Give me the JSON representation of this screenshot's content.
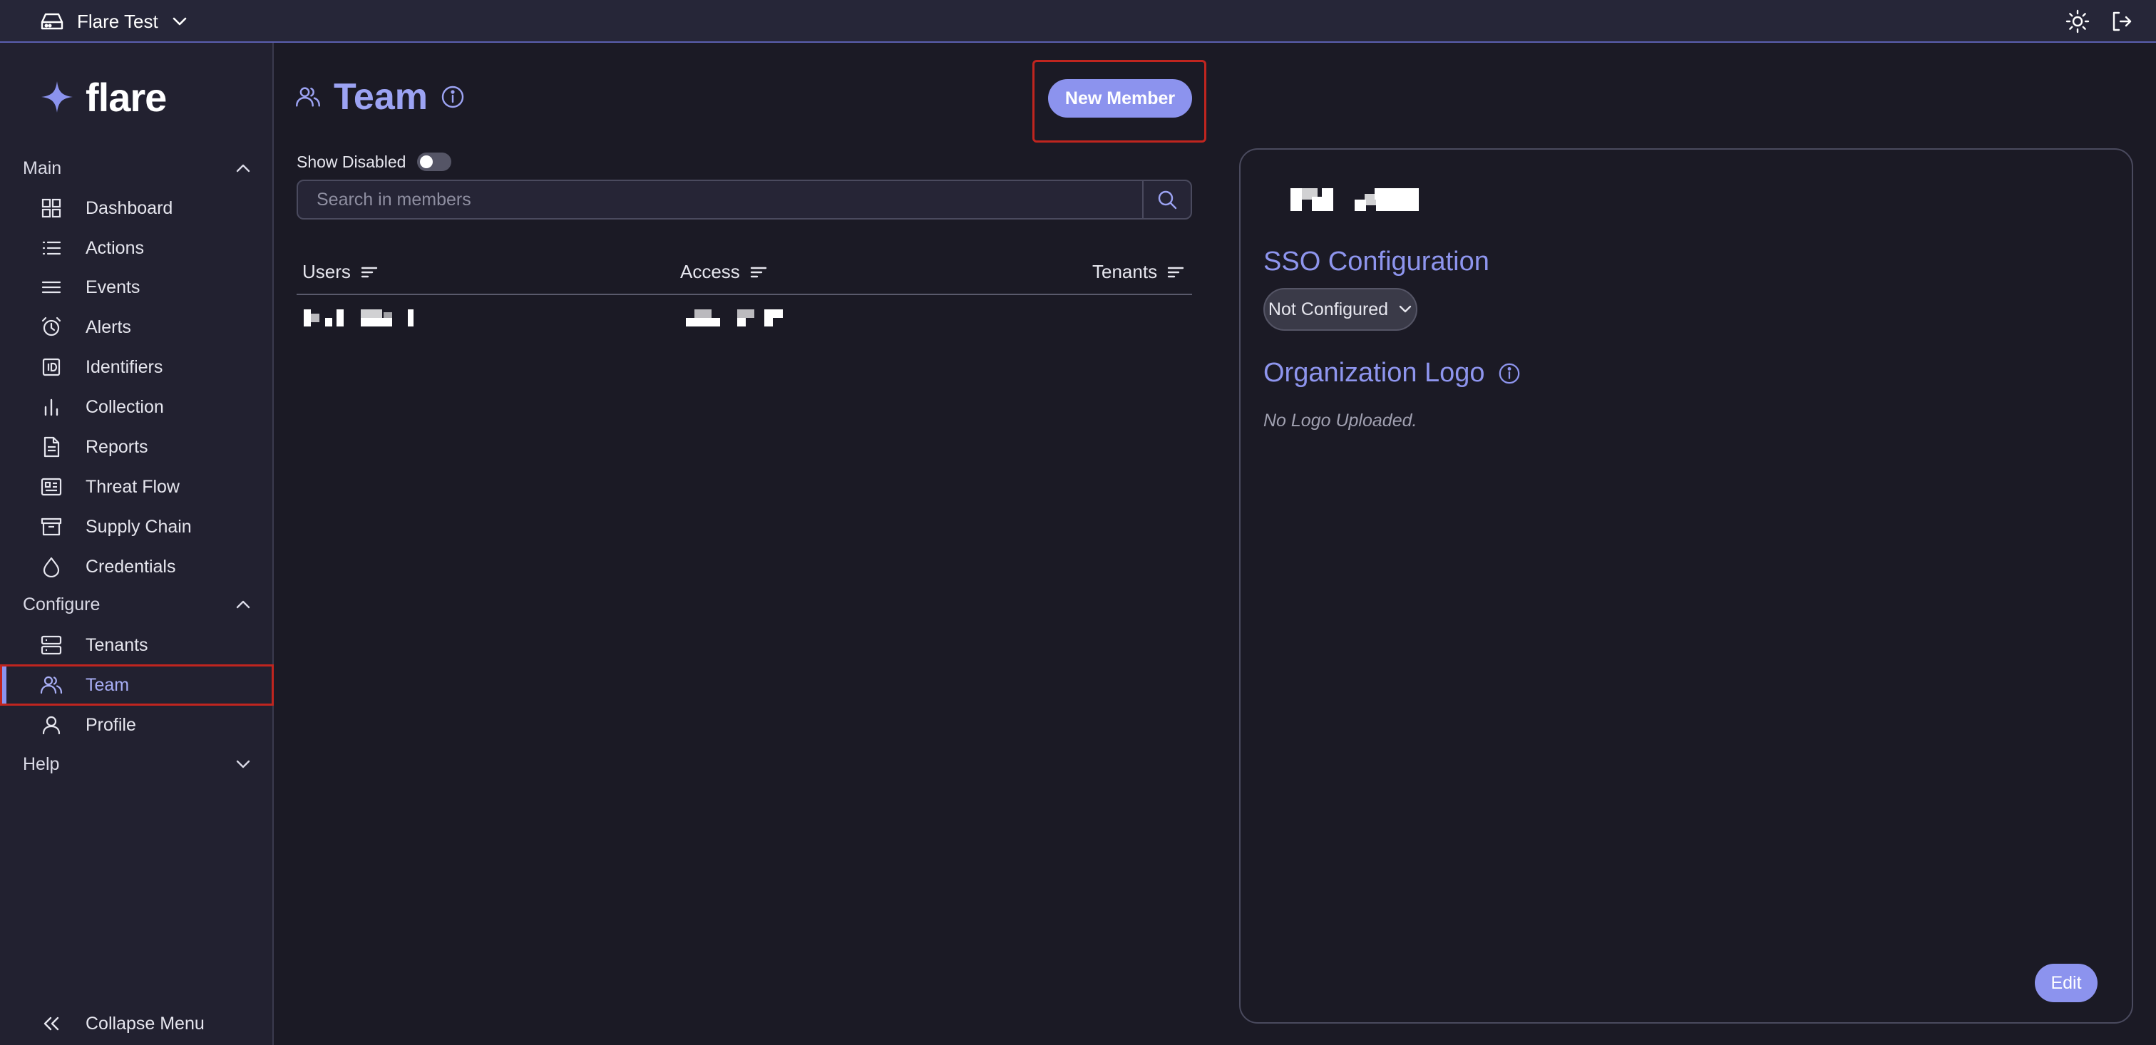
{
  "topbar": {
    "org_name": "Flare Test"
  },
  "brand": {
    "name": "flare"
  },
  "sidebar": {
    "sections": {
      "main": "Main",
      "configure": "Configure",
      "help": "Help"
    },
    "main_items": [
      "Dashboard",
      "Actions",
      "Events",
      "Alerts",
      "Identifiers",
      "Collection",
      "Reports",
      "Threat Flow",
      "Supply Chain",
      "Credentials"
    ],
    "configure_items": [
      "Tenants",
      "Team",
      "Profile"
    ],
    "active_item": "Team",
    "collapse_label": "Collapse Menu"
  },
  "page": {
    "title": "Team",
    "new_member_label": "New Member",
    "show_disabled_label": "Show Disabled",
    "search_placeholder": "Search in members"
  },
  "table": {
    "columns": [
      "Users",
      "Access",
      "Tenants"
    ]
  },
  "org_panel": {
    "sso_heading": "SSO Configuration",
    "sso_value": "Not Configured",
    "logo_heading": "Organization Logo",
    "no_logo_text": "No Logo Uploaded.",
    "edit_label": "Edit"
  },
  "colors": {
    "accent": "#8c93ee",
    "highlight": "#c0251f",
    "background": "#1b1a25",
    "sidebar": "#222130"
  }
}
